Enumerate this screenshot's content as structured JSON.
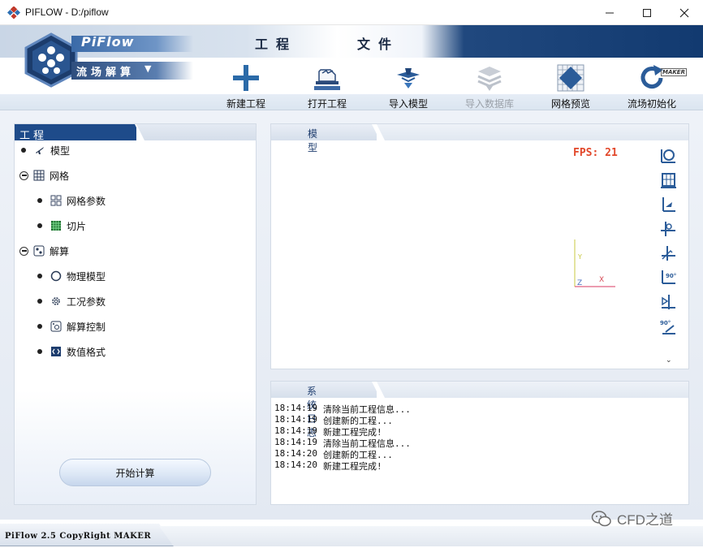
{
  "window": {
    "title": "PIFLOW - D:/piflow",
    "controls": {
      "minimize": "—",
      "maximize": "☐",
      "close": "✕"
    }
  },
  "logo": {
    "brand": "PiFlow",
    "subtitle": "流场解算",
    "caret": "▼",
    "maker_tag": "MAKER"
  },
  "menu": {
    "tabs": [
      "工程",
      "文件",
      "",
      ""
    ]
  },
  "toolbar": {
    "items": [
      {
        "label": "新建工程",
        "icon": "plus-icon",
        "enabled": true
      },
      {
        "label": "打开工程",
        "icon": "open-project-icon",
        "enabled": true
      },
      {
        "label": "导入模型",
        "icon": "import-model-icon",
        "enabled": true
      },
      {
        "label": "导入数据库",
        "icon": "import-database-icon",
        "enabled": false
      },
      {
        "label": "网格预览",
        "icon": "mesh-preview-icon",
        "enabled": true
      },
      {
        "label": "流场初始化",
        "icon": "refresh-icon",
        "enabled": true
      }
    ]
  },
  "project_panel": {
    "title": "工程",
    "tree": [
      {
        "label": "模型",
        "level": 0,
        "marker": "bullet",
        "icon": "airplane-icon"
      },
      {
        "label": "网格",
        "level": 0,
        "marker": "collapse",
        "icon": "grid-icon"
      },
      {
        "label": "网格参数",
        "level": 1,
        "marker": "bullet",
        "icon": "grid-params-icon"
      },
      {
        "label": "切片",
        "level": 1,
        "marker": "bullet",
        "icon": "slice-icon"
      },
      {
        "label": "解算",
        "level": 0,
        "marker": "collapse",
        "icon": "solver-icon"
      },
      {
        "label": "物理模型",
        "level": 1,
        "marker": "bullet",
        "icon": "circle-icon"
      },
      {
        "label": "工况参数",
        "level": 1,
        "marker": "bullet",
        "icon": "gear-icon"
      },
      {
        "label": "解算控制",
        "level": 1,
        "marker": "bullet",
        "icon": "control-icon"
      },
      {
        "label": "数值格式",
        "level": 1,
        "marker": "bullet",
        "icon": "code-icon"
      }
    ],
    "start_button": "开始计算"
  },
  "model_panel": {
    "title": "模型",
    "fps": "FPS: 21",
    "axes": {
      "x": "X",
      "y": "Y",
      "z": "Z"
    },
    "view_tools": [
      "view-reset-icon",
      "view-fit-icon",
      "view-front-icon",
      "view-side-icon",
      "view-top-icon",
      "rotate-90-x-icon",
      "view-flip-icon",
      "rotate-90-z-icon"
    ],
    "more": "⌄"
  },
  "log_panel": {
    "title": "系统日志",
    "lines": [
      {
        "time": "18:14:19",
        "text": "清除当前工程信息..."
      },
      {
        "time": "18:14:19",
        "text": "创建新的工程..."
      },
      {
        "time": "18:14:19",
        "text": "新建工程完成!"
      },
      {
        "time": "18:14:19",
        "text": "清除当前工程信息..."
      },
      {
        "time": "18:14:20",
        "text": "创建新的工程..."
      },
      {
        "time": "18:14:20",
        "text": "新建工程完成!"
      }
    ]
  },
  "statusbar": {
    "text": "PiFlow 2.5 CopyRight MAKER"
  },
  "watermark": {
    "text": "CFD之道"
  },
  "colors": {
    "accent": "#1e4b8a",
    "fps": "#e2472a",
    "disabled": "#9aa0a8"
  }
}
